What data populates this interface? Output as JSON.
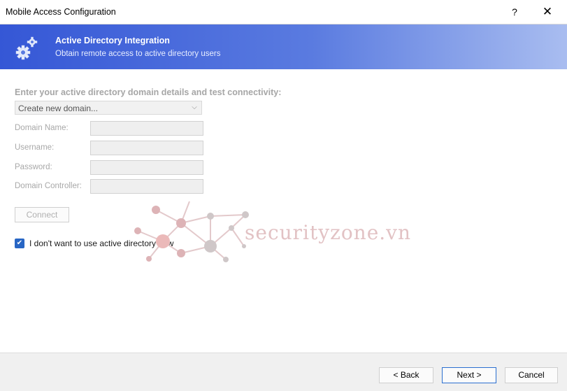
{
  "window": {
    "title": "Mobile Access Configuration",
    "help_label": "?",
    "close_label": "✕"
  },
  "banner": {
    "title": "Active Directory Integration",
    "subtitle": "Obtain remote access to active directory users",
    "icon": "gears-icon",
    "colors": {
      "start": "#3557d6",
      "end": "#a9bdf0"
    }
  },
  "form": {
    "heading": "Enter your active directory domain details and test connectivity:",
    "domain_select": {
      "value": "Create new domain...",
      "chevron": "⌵"
    },
    "fields": [
      {
        "label": "Domain Name:",
        "value": ""
      },
      {
        "label": "Username:",
        "value": ""
      },
      {
        "label": "Password:",
        "value": ""
      },
      {
        "label": "Domain Controller:",
        "value": ""
      }
    ],
    "connect_label": "Connect",
    "checkbox": {
      "checked": true,
      "mark": "✔",
      "label": "I don't want to use active directory now"
    }
  },
  "watermark": {
    "text": "securityzone.vn"
  },
  "footer": {
    "back_label": "< Back",
    "next_label": "Next >",
    "cancel_label": "Cancel"
  }
}
